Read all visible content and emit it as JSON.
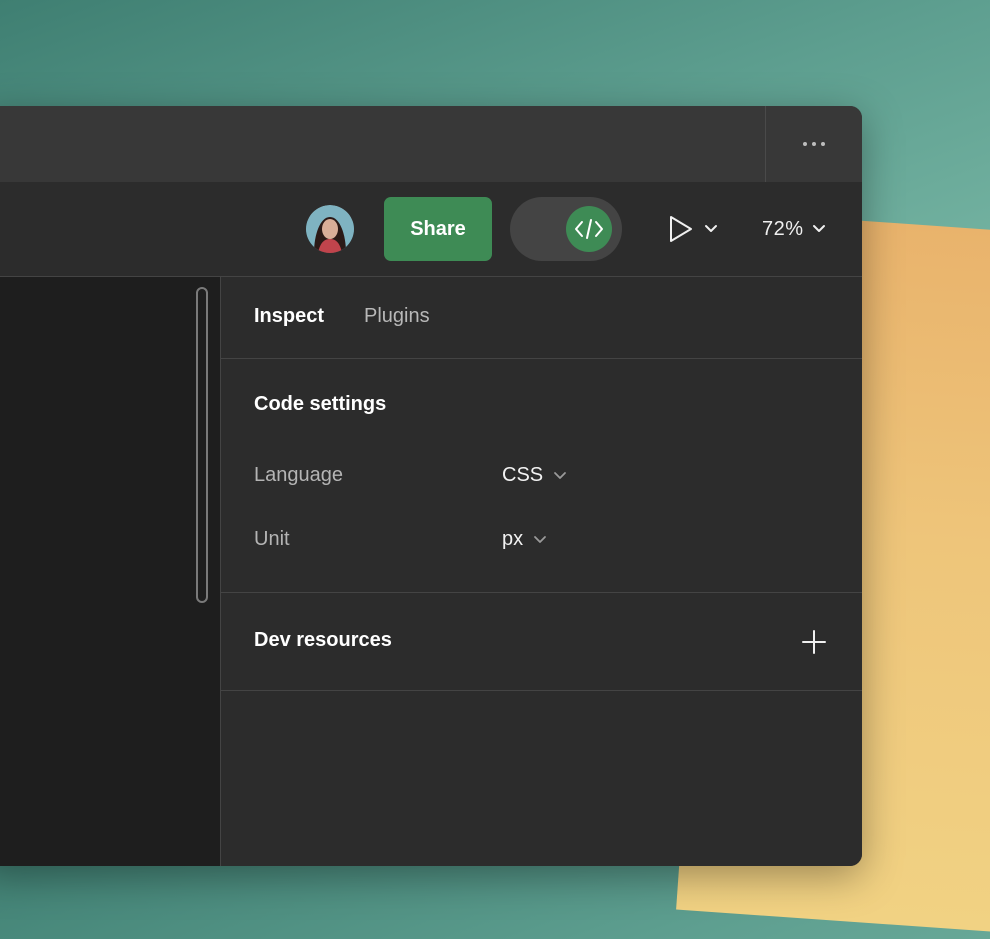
{
  "titlebar": {
    "more_icon": "more-horizontal-icon"
  },
  "toolbar": {
    "avatar_icon": "user-avatar",
    "share_label": "Share",
    "dev_mode_icon": "code-icon",
    "present_icon": "play-icon",
    "zoom_label": "72%"
  },
  "panel": {
    "tabs": [
      {
        "label": "Inspect",
        "active": true
      },
      {
        "label": "Plugins",
        "active": false
      }
    ],
    "code_settings": {
      "title": "Code settings",
      "language_label": "Language",
      "language_value": "CSS",
      "unit_label": "Unit",
      "unit_value": "px"
    },
    "dev_resources": {
      "title": "Dev resources",
      "add_icon": "plus-icon"
    }
  },
  "colors": {
    "accent_green": "#3e8b55",
    "panel_bg": "#2c2c2c",
    "titlebar_bg": "#383838",
    "canvas_bg": "#1e1e1e"
  }
}
